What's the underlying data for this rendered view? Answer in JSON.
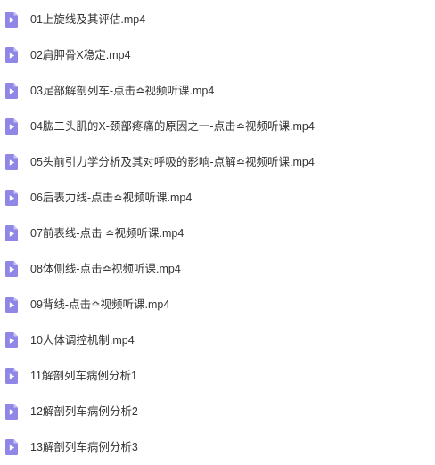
{
  "colors": {
    "icon_body": "#8f86e6",
    "icon_fold": "#c9c3f5",
    "icon_play": "#ffffff",
    "text": "#333333",
    "background": "#ffffff"
  },
  "file_icon": "video-file-icon",
  "files": [
    {
      "name": "01上旋线及其评估.mp4"
    },
    {
      "name": "02肩胛骨X稳定.mp4"
    },
    {
      "name": "03足部解剖列车-点击≏视频听课.mp4"
    },
    {
      "name": "04肱二头肌的X-颈部疼痛的原因之一-点击≏视频听课.mp4"
    },
    {
      "name": "05头前引力学分析及其对呼吸的影响-点解≏视频听课.mp4"
    },
    {
      "name": "06后表力线-点击≏视频听课.mp4"
    },
    {
      "name": "07前表线-点击 ≏视频听课.mp4"
    },
    {
      "name": "08体侧线-点击≏视频听课.mp4"
    },
    {
      "name": "09背线-点击≏视频听课.mp4"
    },
    {
      "name": "10人体调控机制.mp4"
    },
    {
      "name": "11解剖列车病例分析1"
    },
    {
      "name": "12解剖列车病例分析2"
    },
    {
      "name": "13解剖列车病例分析3"
    }
  ]
}
